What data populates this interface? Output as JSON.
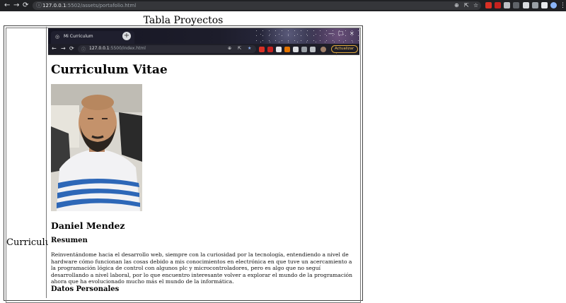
{
  "browser": {
    "url_host": "127.0.0.1",
    "url_rest": ":5502/assets/portafolio.html"
  },
  "page": {
    "title": "Tabla Proyectos",
    "row_label": "Curriculum"
  },
  "embedded_screenshot": {
    "tab_title": "Mi Curriculum",
    "url_host": "127.0.0.1",
    "url_rest": ":5500/index.html",
    "update_button": "Actualizar",
    "cv": {
      "title": "Curriculum Vitae",
      "name": "Daniel Mendez",
      "summary_heading": "Resumen",
      "summary_text": "Reinventándome hacia el desarrollo web, siempre con la curiosidad por la tecnología, entendiendo a nivel de hardware cómo funcionan las cosas debido a mis conocimientos en electrónica en que tuve un acercamiento a la programación lógica de control con algunos plc y microcontroladores, pero es algo que no seguí desarrollando a nivel laboral, por lo que encuentro interesante volver a explorar el mundo de la programación ahora que ha evolucionado mucho más el mundo de la informática.",
      "personal_data_heading": "Datos Personales"
    }
  },
  "icons": {
    "back": "back-arrow-icon",
    "forward": "forward-arrow-icon",
    "reload": "reload-icon",
    "info": "info-icon",
    "zoom": "zoom-icon",
    "share": "share-icon",
    "bookmark": "star-icon",
    "puzzle": "extensions-icon",
    "sidebar": "sidebar-icon",
    "profile": "profile-icon",
    "menu": "kebab-menu-icon"
  }
}
